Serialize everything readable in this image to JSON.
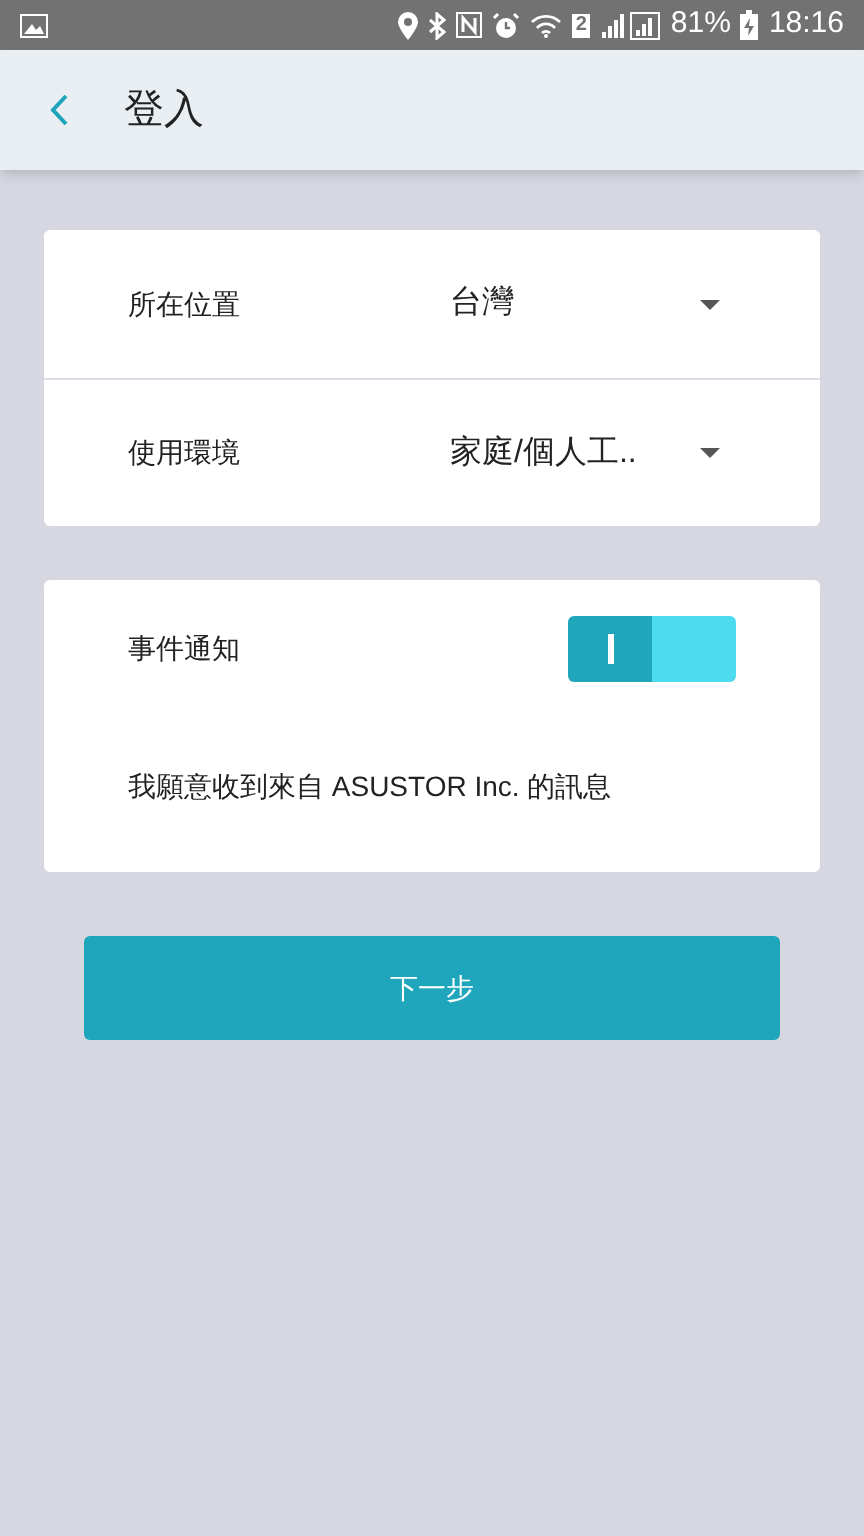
{
  "status_bar": {
    "sim_badge": "2",
    "battery": "81%",
    "time": "18:16"
  },
  "header": {
    "title": "登入"
  },
  "settings": [
    {
      "label": "所在位置",
      "value": "台灣"
    },
    {
      "label": "使用環境",
      "value": "家庭/個人工.."
    }
  ],
  "notification": {
    "label": "事件通知",
    "on": true,
    "description": "我願意收到來自 ASUSTOR Inc. 的訊息"
  },
  "next_button": "下一步"
}
